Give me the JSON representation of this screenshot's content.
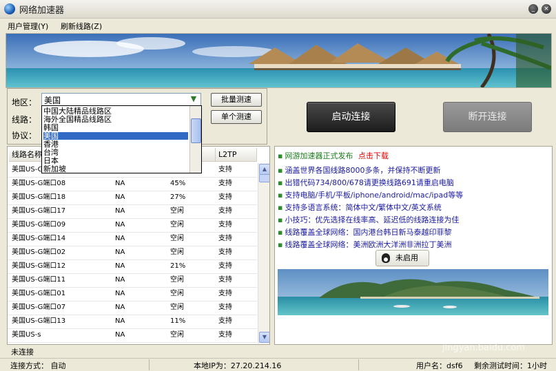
{
  "window": {
    "title": "网络加速器",
    "minimize": "_",
    "close": "×"
  },
  "menu": [
    "用户管理(Y)",
    "刷新线路(Z)"
  ],
  "config": {
    "region_label": "地区：",
    "line_label": "线路：",
    "protocol_label": "协议：",
    "region_value": "美国",
    "batch_test": "批量测速",
    "single_test": "单个测速"
  },
  "dropdown_options": [
    "中国大陆精品线路区",
    "海外全国精品线路区",
    "韩国",
    "美国",
    "香港",
    "台湾",
    "日本",
    "新加坡"
  ],
  "dropdown_selected_index": 3,
  "table": {
    "headers": [
      "线路名称",
      "",
      "",
      "L2TP"
    ],
    "rows": [
      [
        "美国US-G端口",
        "",
        "",
        "支持"
      ],
      [
        "美国US-G端口08",
        "NA",
        "45%",
        "支持"
      ],
      [
        "美国US-G端口18",
        "NA",
        "27%",
        "支持"
      ],
      [
        "美国US-G端口17",
        "NA",
        "空闲",
        "支持"
      ],
      [
        "美国US-G端口09",
        "NA",
        "空闲",
        "支持"
      ],
      [
        "美国US-G端口14",
        "NA",
        "空闲",
        "支持"
      ],
      [
        "美国US-G端口02",
        "NA",
        "空闲",
        "支持"
      ],
      [
        "美国US-G端口12",
        "NA",
        "21%",
        "支持"
      ],
      [
        "美国US-G端口11",
        "NA",
        "空闲",
        "支持"
      ],
      [
        "美国US-G端口01",
        "NA",
        "空闲",
        "支持"
      ],
      [
        "美国US-G端口07",
        "NA",
        "空闲",
        "支持"
      ],
      [
        "美国US-G端口13",
        "NA",
        "11%",
        "支持"
      ],
      [
        "美国US-s",
        "NA",
        "空闲",
        "支持"
      ]
    ]
  },
  "buttons": {
    "connect": "启动连接",
    "disconnect": "断开连接"
  },
  "news": {
    "headline": "网游加速器正式发布",
    "download": "点击下载",
    "lines": [
      "涵盖世界各国线路8000多条，并保持不断更新",
      "出错代码734/800/678请更换线路691请重启电脑",
      "支持电脑/手机/平板/iphone/android/mac/ipad等等",
      "支持多语言系统：简体中文/繁体中文/英文系统",
      "小技巧：优先选择在线率高、延迟低的线路连接为佳",
      "线路覆盖全球网络：国内港台韩日新马泰越印菲黎",
      "线路覆盖全球网络：美洲欧洲大洋洲非洲拉丁美洲"
    ],
    "qq_button": "未启用"
  },
  "status": {
    "connection_state": "未连接",
    "connect_mode": "连接方式： 自动",
    "local_ip": "本地IP为：27.20.214.16",
    "username": "用户名：dsf6",
    "remaining": "剩余测试时间：1小时"
  },
  "watermark": {
    "brand": "Baidu经验",
    "site": "jingyan.baidu.com"
  },
  "colors": {
    "selection": "#316ac5",
    "download_link": "#e00000",
    "headline": "#1a7a1a",
    "news_text": "#1a1aa0"
  }
}
